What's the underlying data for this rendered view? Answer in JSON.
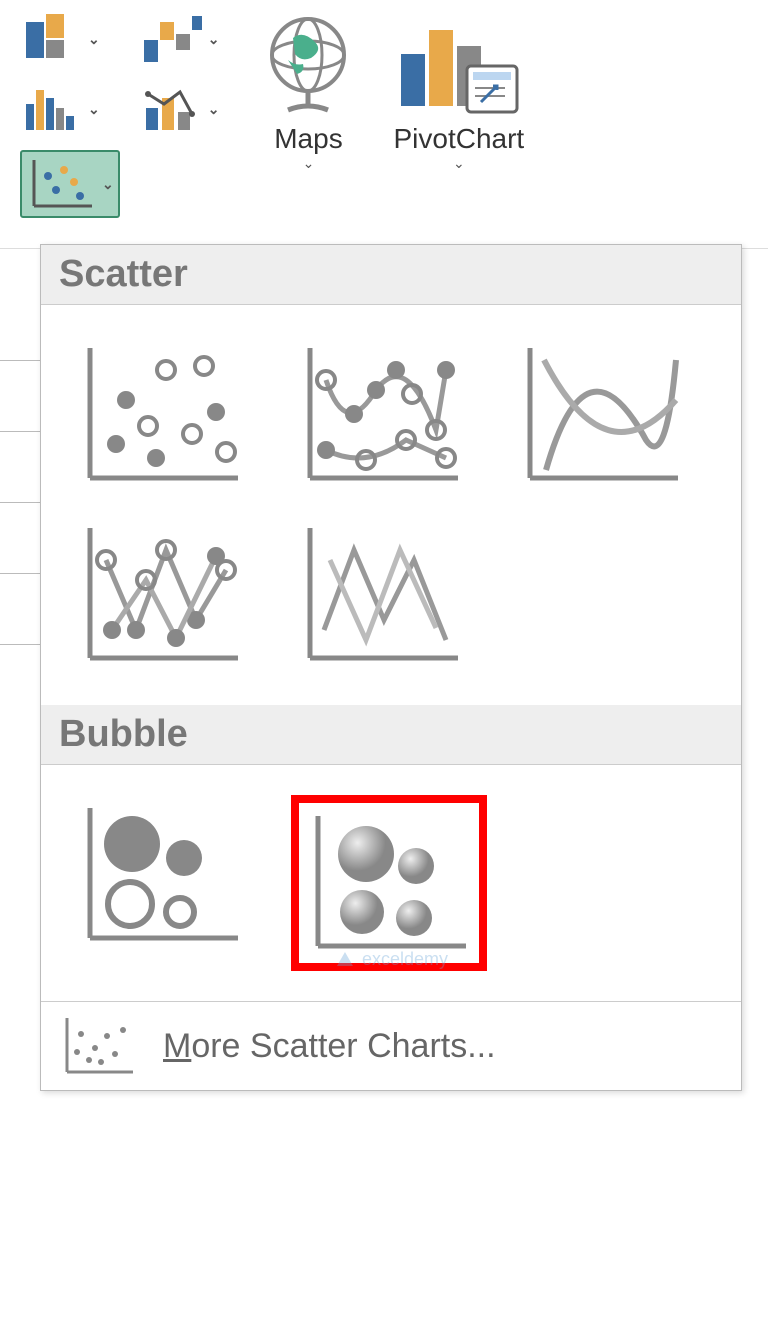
{
  "ribbon": {
    "maps_label": "Maps",
    "pivot_label": "PivotChart"
  },
  "dropdown": {
    "section_scatter": "Scatter",
    "section_bubble": "Bubble",
    "more_label": "More Scatter Charts..."
  },
  "watermark": "exceldemy"
}
